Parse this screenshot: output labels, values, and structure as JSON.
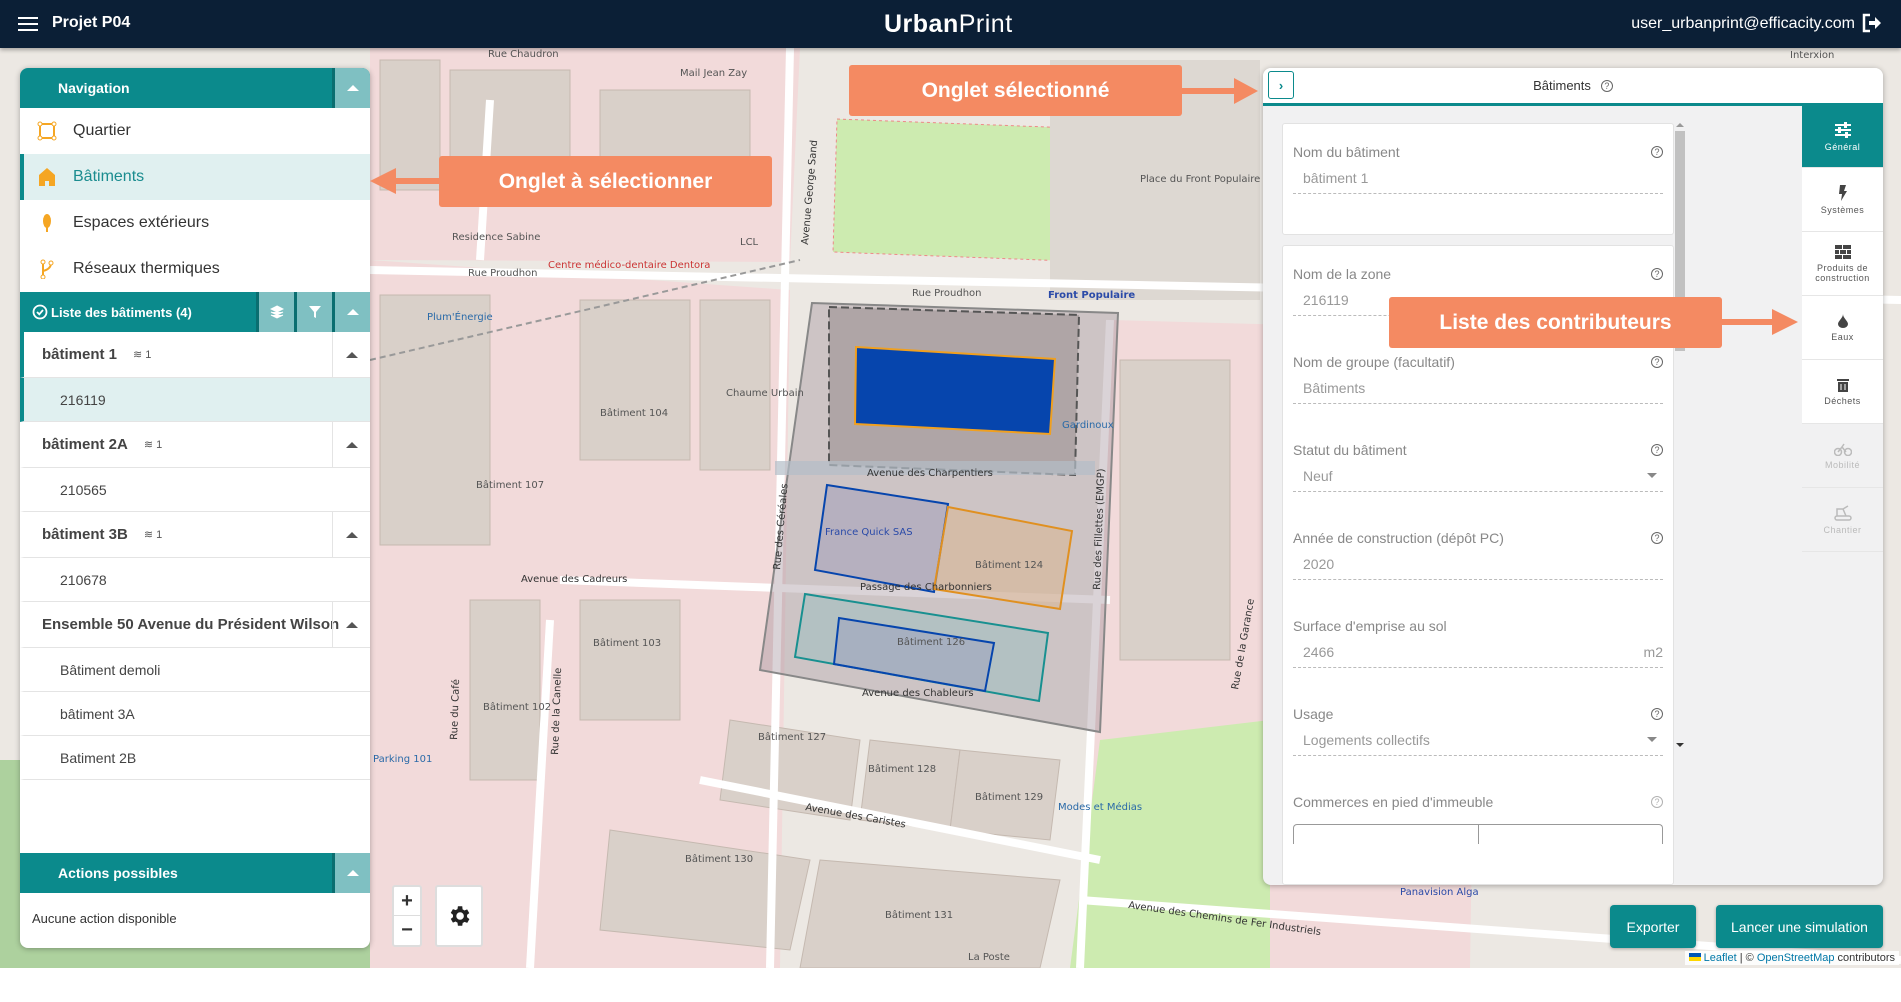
{
  "header": {
    "project": "Projet P04",
    "logo_bold": "Urban",
    "logo_light": "Print",
    "user": "user_urbanprint@efficacity.com",
    "icons": [
      "menu-icon",
      "logout-icon"
    ]
  },
  "nav": {
    "title": "Navigation",
    "items": [
      {
        "label": "Quartier",
        "icon": "square-area-icon"
      },
      {
        "label": "Bâtiments",
        "icon": "house-icon",
        "selected": true
      },
      {
        "label": "Espaces extérieurs",
        "icon": "tree-icon"
      },
      {
        "label": "Réseaux thermiques",
        "icon": "network-icon"
      }
    ]
  },
  "buildings": {
    "title": "Liste des bâtiments (4)",
    "groups": [
      {
        "name": "bâtiment 1",
        "count": "1",
        "items": [
          "216119"
        ]
      },
      {
        "name": "bâtiment 2A",
        "count": "1",
        "items": [
          "210565"
        ]
      },
      {
        "name": "bâtiment 3B",
        "count": "1",
        "items": [
          "210678"
        ]
      },
      {
        "name": "Ensemble 50 Avenue du Président Wilson",
        "items": [
          "Bâtiment demoli",
          "bâtiment 3A",
          "Batiment 2B"
        ]
      }
    ],
    "selected": "216119"
  },
  "actions": {
    "title": "Actions possibles",
    "empty": "Aucune action disponible"
  },
  "right": {
    "title": "Bâtiments",
    "fields": [
      {
        "label": "Nom du bâtiment",
        "value": "bâtiment 1"
      },
      {
        "label": "Nom de la zone",
        "value": "216119"
      },
      {
        "label": "Nom de groupe (facultatif)",
        "value": "Bâtiments"
      },
      {
        "label": "Statut du bâtiment",
        "value": "Neuf"
      },
      {
        "label": "Année de construction (dépôt PC)",
        "value": "2020"
      },
      {
        "label": "Surface d'emprise au sol",
        "value": "2466",
        "unit": "m2"
      },
      {
        "label": "Usage",
        "value": "Logements collectifs"
      },
      {
        "label": "Commerces en pied d'immeuble"
      }
    ],
    "tabs": [
      {
        "label": "Général",
        "icon": "sliders-icon",
        "active": true
      },
      {
        "label": "Systèmes",
        "icon": "lightning-icon"
      },
      {
        "label": "Produits de construction",
        "icon": "bricks-icon"
      },
      {
        "label": "Eaux",
        "icon": "drop-icon"
      },
      {
        "label": "Déchets",
        "icon": "trash-icon"
      },
      {
        "label": "Mobilité",
        "icon": "bike-icon",
        "disabled": true
      },
      {
        "label": "Chantier",
        "icon": "excavator-icon",
        "disabled": true
      }
    ]
  },
  "buttons": {
    "export": "Exporter",
    "simulate": "Lancer une simulation"
  },
  "map_controls": {
    "zoom_in": "+",
    "zoom_out": "−"
  },
  "attribution": {
    "leaflet": "Leaflet",
    "sep": " | © ",
    "osm": "OpenStreetMap",
    "contrib": " contributors"
  },
  "annotations": {
    "selected_tab": "Onglet sélectionné",
    "tab_to_select": "Onglet à sélectionner",
    "contributors": "Liste des contributeurs"
  },
  "colors": {
    "header": "#0b1f36",
    "teal": "#0b8a8c",
    "annotation": "#f48a62"
  },
  "map": {
    "labels": [
      "Rue Chaudron",
      "Mail Jean Zay",
      "Rue Proudhon",
      "Rue Proudhon",
      "Front Populaire",
      "Place du Front Populaire",
      "Residence Sabine",
      "Centre médico-dentaire Dentora",
      "Plum'Énergie",
      "Chaume Urbain",
      "Bâtiment 104",
      "Bâtiment 107",
      "Avenue des Charpentiers",
      "France Quick SAS",
      "Bâtiment 124",
      "Passage des Charbonniers",
      "Bâtiment 126",
      "Avenue des Chableurs",
      "Avenue des Cadreurs",
      "Bâtiment 103",
      "Bâtiment 102",
      "Rue du Café",
      "Rue de la Canelle",
      "Parking 101",
      "Bâtiment 127",
      "Bâtiment 128",
      "Bâtiment 129",
      "Avenue des Caristes",
      "Modes et Médias",
      "Bâtiment 130",
      "Bâtiment 131",
      "Avenue des Chemins de Fer Industriels",
      "Panavision Alga",
      "Rue des Fillettes (EMGP)",
      "Rue des Céréales",
      "Avenue George Sand",
      "Rue de la Garance",
      "Interxion",
      "La Poste",
      "LCL",
      "Gardinoux"
    ]
  }
}
